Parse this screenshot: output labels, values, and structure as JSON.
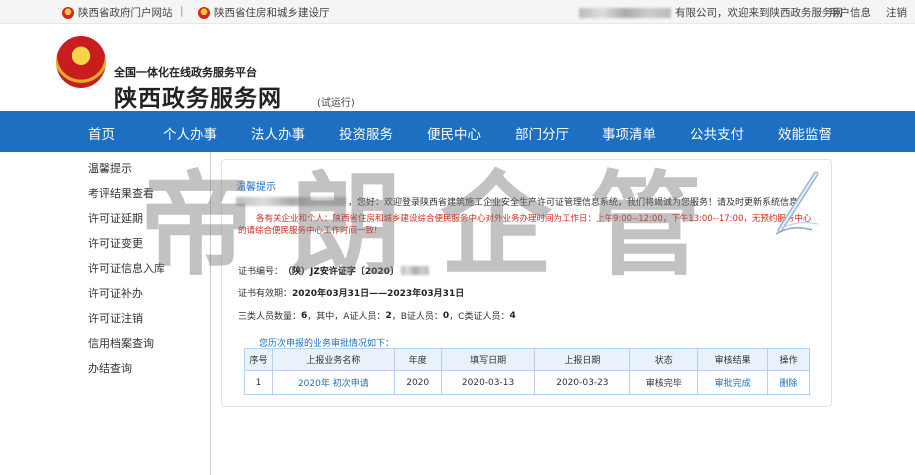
{
  "topbar": {
    "link1": "陕西省政府门户网站",
    "link2": "陕西省住房和城乡建设厅",
    "company_suffix": "有限公司，欢迎来到陕西政务服务网",
    "user_info": "用户信息",
    "logout": "注销"
  },
  "header": {
    "subtitle": "全国一体化在线政务服务平台",
    "title": "陕西政务服务网",
    "trial": "(试运行)"
  },
  "nav": {
    "items": [
      "首页",
      "个人办事",
      "法人办事",
      "投资服务",
      "便民中心",
      "部门分厅",
      "事项清单",
      "公共支付",
      "效能监督"
    ]
  },
  "sidebar": {
    "items": [
      "温馨提示",
      "考评结果查看",
      "许可证延期",
      "许可证变更",
      "许可证信息入库",
      "许可证补办",
      "许可证注销",
      "信用档案查询",
      "办结查询"
    ]
  },
  "notice": {
    "title": "温馨提示",
    "welcome": "，您好：欢迎登录陕西省建筑施工企业安全生产许可证管理信息系统，我们将竭诚为您服务！请及时更新系统信息",
    "red_text": "各有关企业和个人：陕西省住房和城乡建设综合便民服务中心对外业务办理时间为工作日：上午9:00--12:00，下午13:00--17:00，无预约服务中心的请综合便民服务中心工作时间一致!"
  },
  "cert": {
    "number_label": "证书编号：",
    "number_value": "（陕）JZ安许证字〔2020〕",
    "validity_label": "证书有效期：",
    "validity_value": "2020年03月31日——2023年03月31日",
    "staff_prefix": "三类人员数量：",
    "staff_total": "6",
    "staff_mid": "，其中，A证人员：",
    "staff_a": "2",
    "staff_b_label": "，B证人员：",
    "staff_b": "0",
    "staff_c_label": "，C类证人员：",
    "staff_c": "4"
  },
  "history": {
    "caption": "您历次申报的业务审批情况如下：",
    "headers": [
      "序号",
      "上报业务名称",
      "年度",
      "填写日期",
      "上报日期",
      "状态",
      "审核结果",
      "操作"
    ],
    "rows": [
      {
        "no": "1",
        "name": "2020年 初次申请",
        "year": "2020",
        "fill_date": "2020-03-13",
        "report_date": "2020-03-23",
        "status": "审核完毕",
        "result": "审批完成",
        "action": "删除"
      }
    ]
  },
  "watermark": "帝朗企管",
  "colors": {
    "nav_bg": "#1c6fc1",
    "link": "#1c6fc1",
    "notice_red": "#d8261b"
  }
}
